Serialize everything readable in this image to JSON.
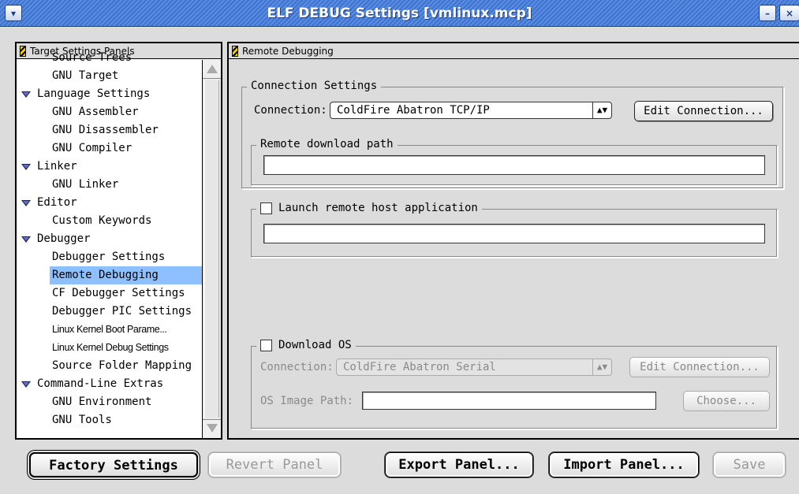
{
  "window": {
    "title": "ELF DEBUG Settings [vmlinux.mcp]",
    "collapse_icon": "chevron-down-icon",
    "minimize_icon": "minimize-icon",
    "close_icon": "close-icon"
  },
  "left_panel": {
    "header": "Target Settings Panels",
    "tree": [
      {
        "label": "Source Trees",
        "type": "child"
      },
      {
        "label": "GNU Target",
        "type": "child"
      },
      {
        "label": "Language Settings",
        "type": "group"
      },
      {
        "label": "GNU Assembler",
        "type": "child"
      },
      {
        "label": "GNU Disassembler",
        "type": "child"
      },
      {
        "label": "GNU Compiler",
        "type": "child"
      },
      {
        "label": "Linker",
        "type": "group"
      },
      {
        "label": "GNU Linker",
        "type": "child"
      },
      {
        "label": "Editor",
        "type": "group"
      },
      {
        "label": "Custom Keywords",
        "type": "child"
      },
      {
        "label": "Debugger",
        "type": "group"
      },
      {
        "label": "Debugger Settings",
        "type": "child"
      },
      {
        "label": "Remote Debugging",
        "type": "child",
        "selected": true
      },
      {
        "label": "CF Debugger Settings",
        "type": "child"
      },
      {
        "label": "Debugger PIC Settings",
        "type": "child"
      },
      {
        "label": "Linux Kernel Boot Parame...",
        "type": "child",
        "narrow": true
      },
      {
        "label": "Linux Kernel Debug Settings",
        "type": "child",
        "narrow": true
      },
      {
        "label": "Source Folder Mapping",
        "type": "child"
      },
      {
        "label": "Command-Line Extras",
        "type": "group"
      },
      {
        "label": "GNU Environment",
        "type": "child"
      },
      {
        "label": "GNU Tools",
        "type": "child"
      }
    ]
  },
  "right_panel": {
    "header": "Remote Debugging",
    "connection_settings": {
      "legend": "Connection Settings",
      "connection_label": "Connection:",
      "connection_value": "ColdFire Abatron TCP/IP",
      "edit_button": "Edit Connection..."
    },
    "remote_download": {
      "legend": "Remote download path",
      "value": ""
    },
    "launch_remote": {
      "legend": "Launch remote host application",
      "checked": false,
      "value": ""
    },
    "download_os": {
      "legend": "Download OS",
      "checked": false,
      "connection_label": "Connection:",
      "connection_value": "ColdFire Abatron Serial",
      "edit_button": "Edit Connection...",
      "os_image_label": "OS Image Path:",
      "os_image_value": "",
      "choose_button": "Choose..."
    }
  },
  "footer": {
    "factory_settings": "Factory Settings",
    "revert_panel": "Revert Panel",
    "export_panel": "Export Panel...",
    "import_panel": "Import Panel...",
    "save": "Save"
  },
  "colors": {
    "title_bar": "#3e73cf",
    "selection": "#8ec0ff",
    "window_bg": "#dcdcdc"
  }
}
